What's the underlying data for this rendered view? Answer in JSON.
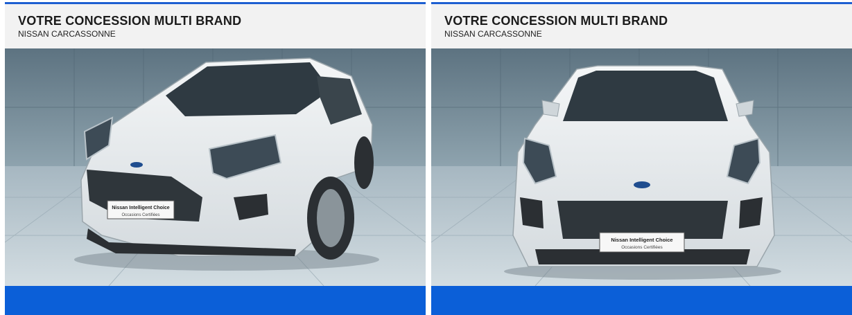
{
  "cards": [
    {
      "title": "VOTRE CONCESSION MULTI BRAND",
      "subtitle": "NISSAN CARCASSONNE",
      "photo": {
        "view": "three-quarter-front",
        "car_color": "#e9ecee",
        "plate_line1": "Nissan Intelligent Choice",
        "plate_line2": "Occasions Certifiées"
      }
    },
    {
      "title": "VOTRE CONCESSION MULTI BRAND",
      "subtitle": "NISSAN CARCASSONNE",
      "photo": {
        "view": "front",
        "car_color": "#e9ecee",
        "plate_line1": "Nissan Intelligent Choice",
        "plate_line2": "Occasions Certifiées"
      }
    }
  ],
  "colors": {
    "accent": "#1d5fd1",
    "footer": "#0b5fd8",
    "header_bg": "#f2f2f2",
    "wall": "#6f8591",
    "floor": "#b7c6cf"
  }
}
